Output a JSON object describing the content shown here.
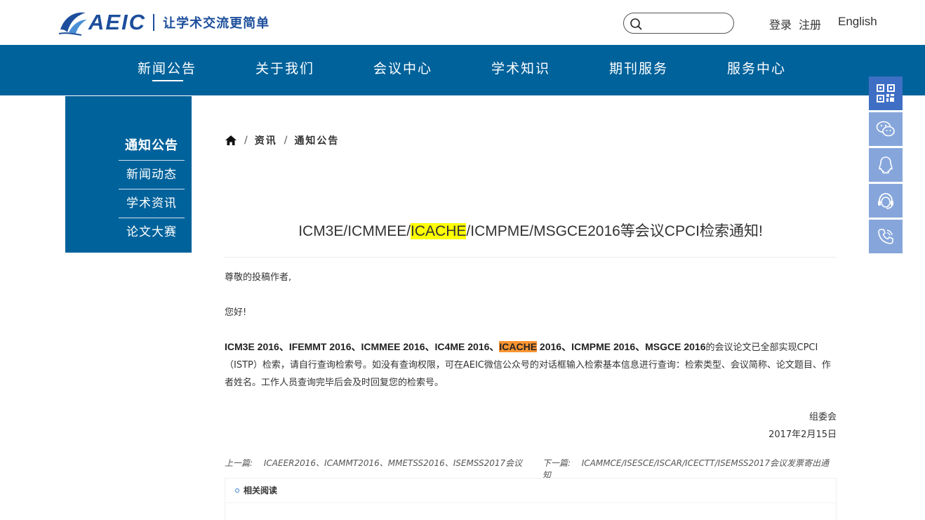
{
  "header": {
    "logo_text": "AEIC",
    "slogan": "让学术交流更简单",
    "search_placeholder": "",
    "login": "登录",
    "register": "注册",
    "language": "English"
  },
  "nav": {
    "items": [
      "新闻公告",
      "关于我们",
      "会议中心",
      "学术知识",
      "期刊服务",
      "服务中心"
    ]
  },
  "sidebar": {
    "items": [
      "通知公告",
      "新闻动态",
      "学术资讯",
      "论文大赛"
    ]
  },
  "breadcrumb": {
    "level1": "资讯",
    "level2": "通知公告",
    "sep": "/"
  },
  "article": {
    "title_pre": "ICM3E/ICMMEE/",
    "title_hl": "ICACHE",
    "title_post": "/ICMPME/MSGCE2016等会议CPCI检索通知!",
    "greeting": "尊敬的投稿作者,",
    "hello": "您好!",
    "body_bold_pre": "ICM3E 2016、IFEMMT 2016、ICMMEE 2016、IC4ME 2016、",
    "body_bold_hl": "ICACHE",
    "body_bold_post": " 2016、ICMPME 2016、MSGCE 2016",
    "body_rest": "的会议论文已全部实现CPCI（ISTP）检索，请自行查询检索号。如没有查询权限，可在AEIC微信公众号的对话框输入检索基本信息进行查询：检索类型、会议简称、论文题目、作者姓名。工作人员查询完毕后会及时回复您的检索号。",
    "signature": "组委会",
    "date": "2017年2月15日"
  },
  "prevnext": {
    "prev_label": "上一篇:",
    "prev_title": "ICAEER2016、ICAMMT2016、MMETSS2016、ISEMSS2017会议",
    "next_label": "下一篇:",
    "next_title": "ICAMMCE/ISESCE/ISCAR/ICECTT/ISEMSS2017会议发票寄出通知"
  },
  "related": {
    "heading": "相关阅读"
  },
  "float_buttons": [
    "qrcode-icon",
    "wechat-icon",
    "qq-icon",
    "customer-service-icon",
    "phone-icon"
  ],
  "colors": {
    "primary": "#00629b",
    "brand": "#1c4e9c",
    "float_active": "#3e6fc5",
    "float": "#86a6db",
    "highlight_yellow": "#ffff00",
    "highlight_orange": "#ff9632"
  }
}
